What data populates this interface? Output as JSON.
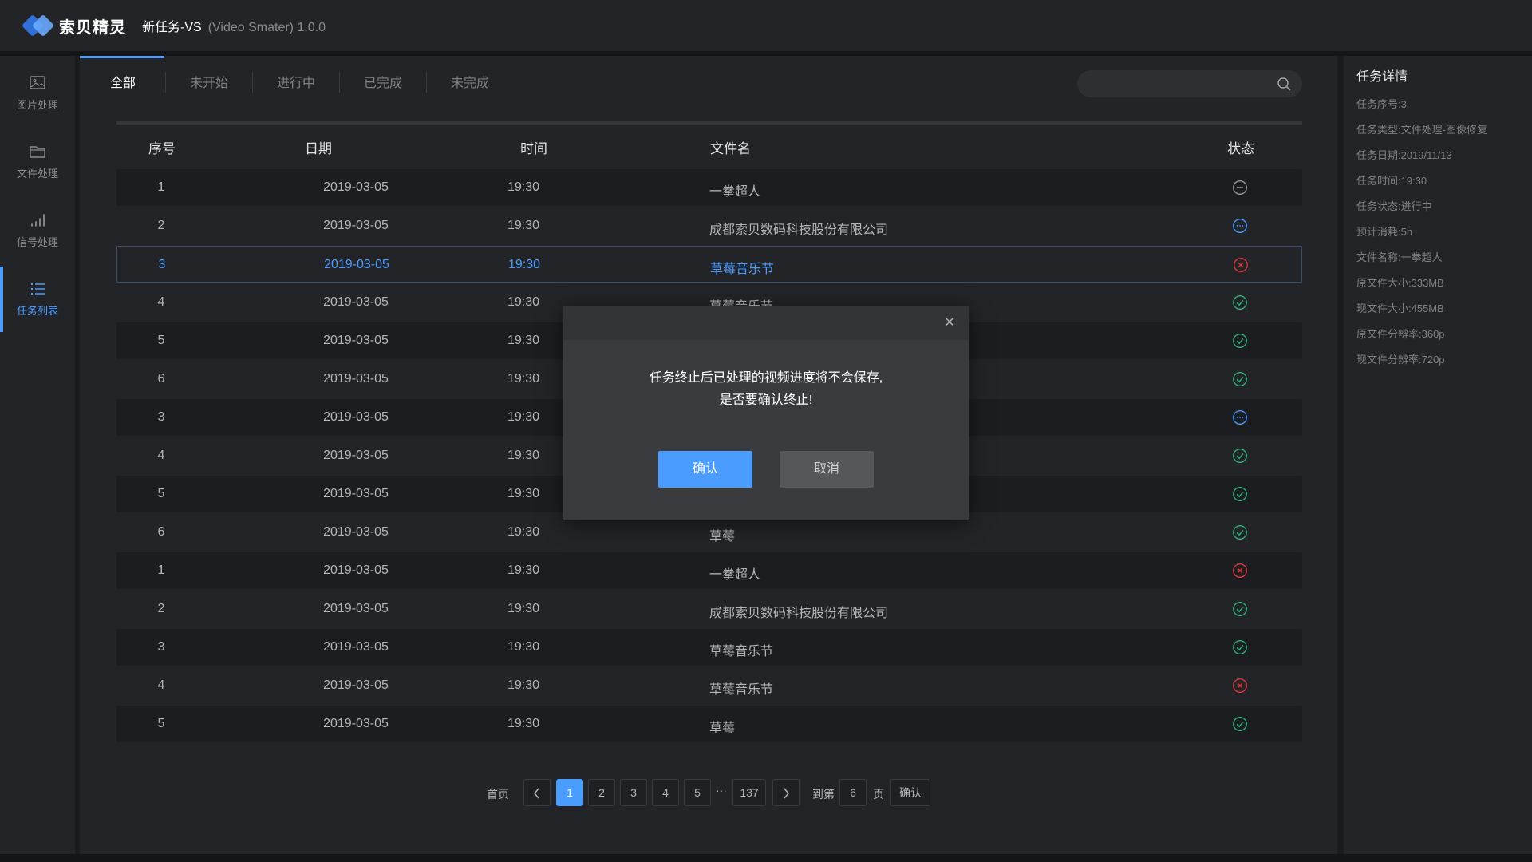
{
  "app": {
    "brand": "索贝精灵",
    "title": "新任务-VS",
    "subtitle": "(Video Smater) 1.0.0"
  },
  "sidebar": {
    "items": [
      {
        "label": "图片处理",
        "icon": "image-icon"
      },
      {
        "label": "文件处理",
        "icon": "folder-icon"
      },
      {
        "label": "信号处理",
        "icon": "signal-icon"
      },
      {
        "label": "任务列表",
        "icon": "list-icon",
        "active": true
      }
    ]
  },
  "tabs": [
    "全部",
    "未开始",
    "进行中",
    "已完成",
    "未完成"
  ],
  "search": {
    "placeholder": ""
  },
  "table": {
    "headers": {
      "index": "序号",
      "date": "日期",
      "time": "时间",
      "file": "文件名",
      "status": "状态"
    },
    "rows": [
      {
        "index": "1",
        "date": "2019-03-05",
        "time": "19:30",
        "file": "一拳超人",
        "status": "pending"
      },
      {
        "index": "2",
        "date": "2019-03-05",
        "time": "19:30",
        "file": "成都索贝数码科技股份有限公司",
        "status": "running"
      },
      {
        "index": "3",
        "date": "2019-03-05",
        "time": "19:30",
        "file": "草莓音乐节",
        "status": "failed"
      },
      {
        "index": "4",
        "date": "2019-03-05",
        "time": "19:30",
        "file": "草莓音乐节",
        "status": "done"
      },
      {
        "index": "5",
        "date": "2019-03-05",
        "time": "19:30",
        "file": "",
        "status": "done"
      },
      {
        "index": "6",
        "date": "2019-03-05",
        "time": "19:30",
        "file": "",
        "status": "done"
      },
      {
        "index": "3",
        "date": "2019-03-05",
        "time": "19:30",
        "file": "",
        "status": "running"
      },
      {
        "index": "4",
        "date": "2019-03-05",
        "time": "19:30",
        "file": "",
        "status": "done"
      },
      {
        "index": "5",
        "date": "2019-03-05",
        "time": "19:30",
        "file": "",
        "status": "done"
      },
      {
        "index": "6",
        "date": "2019-03-05",
        "time": "19:30",
        "file": "草莓",
        "status": "done"
      },
      {
        "index": "1",
        "date": "2019-03-05",
        "time": "19:30",
        "file": "一拳超人",
        "status": "failed"
      },
      {
        "index": "2",
        "date": "2019-03-05",
        "time": "19:30",
        "file": "成都索贝数码科技股份有限公司",
        "status": "done"
      },
      {
        "index": "3",
        "date": "2019-03-05",
        "time": "19:30",
        "file": "草莓音乐节",
        "status": "done"
      },
      {
        "index": "4",
        "date": "2019-03-05",
        "time": "19:30",
        "file": "草莓音乐节",
        "status": "failed"
      },
      {
        "index": "5",
        "date": "2019-03-05",
        "time": "19:30",
        "file": "草莓",
        "status": "done"
      }
    ],
    "selected_row": 3
  },
  "pagination": {
    "first": "首页",
    "pages": [
      "1",
      "2",
      "3",
      "4",
      "5"
    ],
    "ellipsis": "···",
    "last_page": "137",
    "goto_prefix": "到第",
    "goto_value": "6",
    "goto_suffix": "页",
    "confirm": "确认",
    "current": "1"
  },
  "detail": {
    "title": "任务详情",
    "lines": [
      "任务序号:3",
      "任务类型:文件处理-图像修复",
      "任务日期:2019/11/13",
      "任务时间:19:30",
      "任务状态:进行中",
      "预计消耗:5h",
      "文件名称:一拳超人",
      "原文件大小:333MB",
      "现文件大小:455MB",
      "原文件分辨率:360p",
      "现文件分辨率:720p"
    ]
  },
  "modal": {
    "close": "×",
    "message_line1": "任务终止后已处理的视频进度将不会保存,",
    "message_line2": "是否要确认终止!",
    "ok": "确认",
    "cancel": "取消"
  },
  "colors": {
    "accent": "#4a9dff",
    "success": "#2fb37a",
    "error": "#e0393e",
    "pending": "#9a9ca0",
    "running": "#4a9dff"
  }
}
